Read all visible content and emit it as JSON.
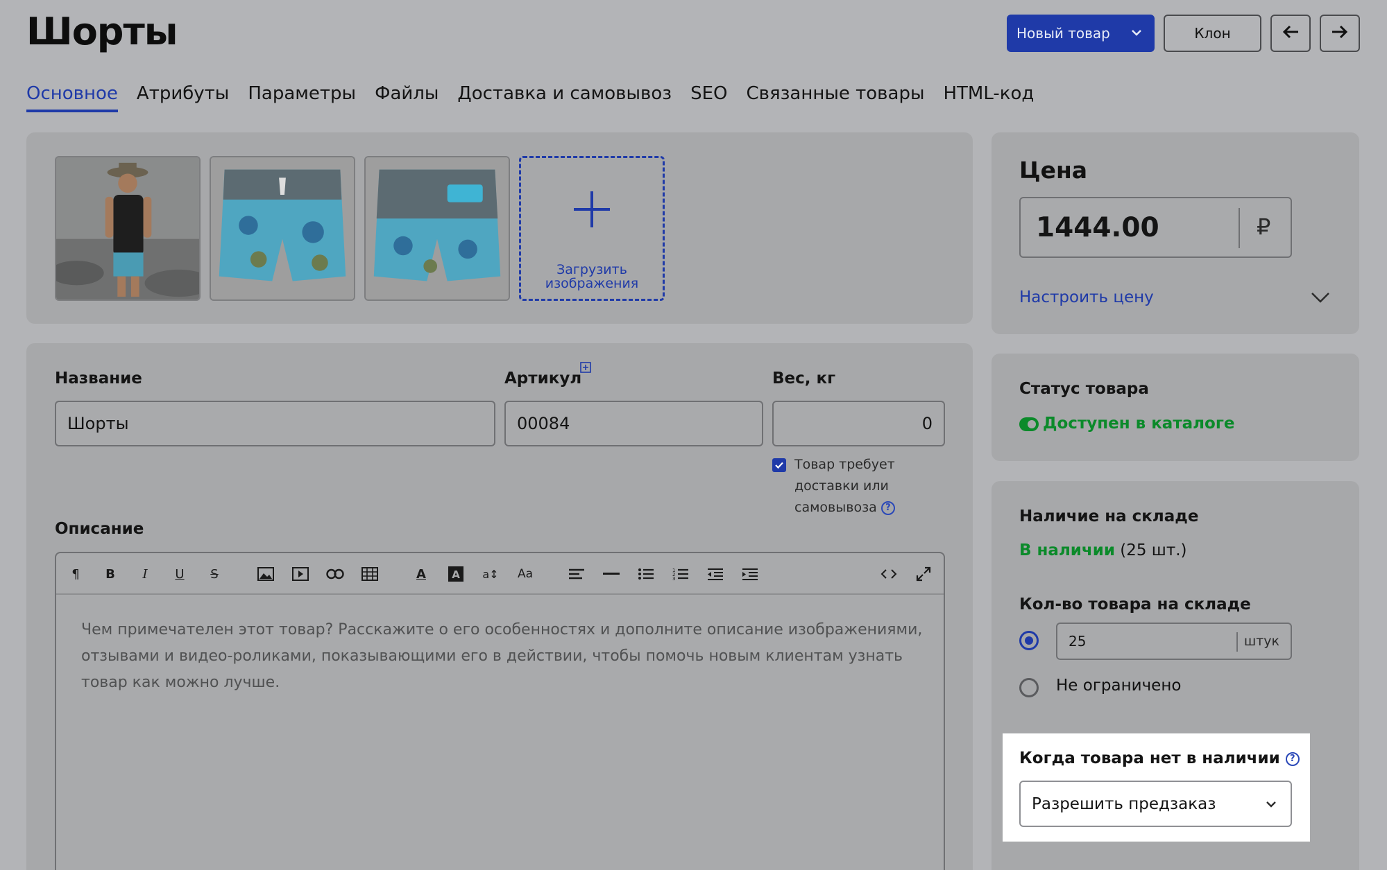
{
  "header": {
    "title": "Шорты",
    "new_product_label": "Новый товар",
    "clone_label": "Клон"
  },
  "tabs": [
    {
      "label": "Основное",
      "active": true
    },
    {
      "label": "Атрибуты"
    },
    {
      "label": "Параметры"
    },
    {
      "label": "Файлы"
    },
    {
      "label": "Доставка и самовывоз"
    },
    {
      "label": "SEO"
    },
    {
      "label": "Связанные товары"
    },
    {
      "label": "HTML-код"
    }
  ],
  "images": {
    "upload_label_1": "Загрузить",
    "upload_label_2": "изображения"
  },
  "form": {
    "name_label": "Название",
    "name_value": "Шорты",
    "sku_label": "Артикул",
    "sku_value": "00084",
    "weight_label": "Вес, кг",
    "weight_value": "0",
    "delivery_line1": "Товар требует",
    "delivery_line2": "доставки или",
    "delivery_line3": "самовывоза",
    "description_label": "Описание",
    "description_placeholder": "Чем примечателен этот товар? Расскажите о его особенностях и дополните описание изображениями, отзывами и видео-роликами, показывающими его в действии, чтобы помочь новым клиентам узнать товар как можно лучше."
  },
  "price": {
    "title": "Цена",
    "value": "1444.00",
    "currency": "₽",
    "configure_label": "Настроить цену"
  },
  "status": {
    "title": "Статус товара",
    "value": "Доступен в каталоге"
  },
  "stock": {
    "title": "Наличие на складе",
    "in_stock": "В наличии",
    "count_text": "(25 шт.)",
    "qty_label": "Кол-во товара на складе",
    "qty_value": "25",
    "qty_unit": "штук",
    "unlimited_label": "Не ограничено",
    "oos_label": "Когда товара нет в наличии",
    "oos_select_value": "Разрешить предзаказ"
  },
  "colors": {
    "accent": "#1f3aa8",
    "success": "#0b8a2a"
  }
}
